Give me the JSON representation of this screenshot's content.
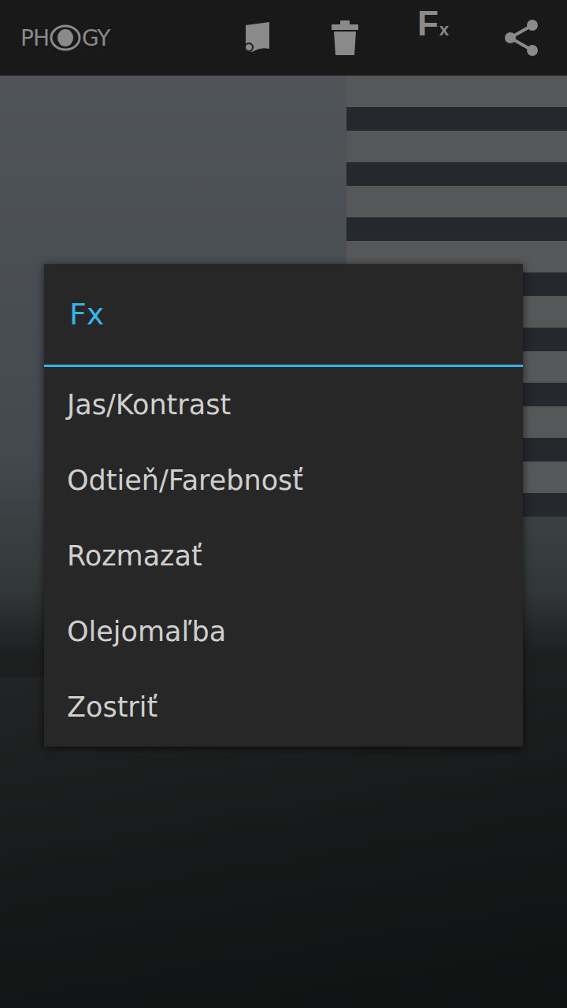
{
  "app_bar": {
    "logo": {
      "left": "PH",
      "right": "GY"
    },
    "fx_button": {
      "main": "F",
      "sub": "x"
    }
  },
  "dialog": {
    "title": "Fx",
    "items": [
      "Jas/Kontrast",
      "Odtieň/Farebnosť",
      "Rozmazať",
      "Olejomaľba",
      "Zostriť"
    ]
  }
}
